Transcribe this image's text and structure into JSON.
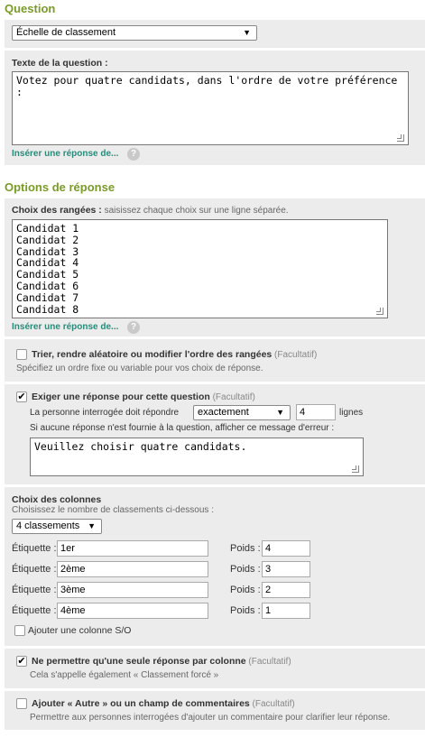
{
  "question": {
    "heading": "Question",
    "type_select": "Échelle de classement",
    "text_label": "Texte de la question :",
    "text_value": "Votez pour quatre candidats, dans l'ordre de votre préférence\n:",
    "insert_link": "Insérer une réponse de...",
    "help": "?"
  },
  "options": {
    "heading": "Options de réponse",
    "rows_label": "Choix des rangées :",
    "rows_hint": "saisissez chaque choix sur une ligne séparée.",
    "rows_value": "Candidat 1\nCandidat 2\nCandidat 3\nCandidat 4\nCandidat 5\nCandidat 6\nCandidat 7\nCandidat 8",
    "insert_link": "Insérer une réponse de...",
    "help": "?"
  },
  "sort": {
    "label": "Trier, rendre aléatoire ou modifier l'ordre des rangées",
    "optional": "(Facultatif)",
    "desc": "Spécifiez un ordre fixe ou variable pour vos choix de réponse."
  },
  "require": {
    "label": "Exiger une réponse pour cette question",
    "optional": "(Facultatif)",
    "must_answer": "La personne interrogée doit répondre",
    "mode": "exactement",
    "count": "4",
    "lines": "lignes",
    "error_hint": "Si aucune réponse n'est fournie à la question, afficher ce message d'erreur :",
    "error_message": "Veuillez choisir quatre candidats."
  },
  "columns": {
    "heading": "Choix des colonnes",
    "hint": "Choisissez le nombre de classements ci-dessous :",
    "count_select": "4 classements",
    "label_text": "Étiquette :",
    "weight_text": "Poids :",
    "rows": [
      {
        "label": "1er",
        "weight": "4"
      },
      {
        "label": "2ème",
        "weight": "3"
      },
      {
        "label": "3ème",
        "weight": "2"
      },
      {
        "label": "4ème",
        "weight": "1"
      }
    ],
    "na_label": "Ajouter une colonne S/O"
  },
  "forced": {
    "label": "Ne permettre qu'une seule réponse par colonne",
    "optional": "(Facultatif)",
    "desc": "Cela s'appelle également « Classement forcé »"
  },
  "other": {
    "label": "Ajouter « Autre » ou un champ de commentaires",
    "optional": "(Facultatif)",
    "desc": "Permettre aux personnes interrogées d'ajouter un commentaire pour clarifier leur réponse."
  },
  "icons": {
    "checkmark": "✔",
    "select_arrow": "▼"
  },
  "colors": {
    "heading": "#7a9a2a",
    "link": "#2a8a7a",
    "panel": "#ececec"
  }
}
